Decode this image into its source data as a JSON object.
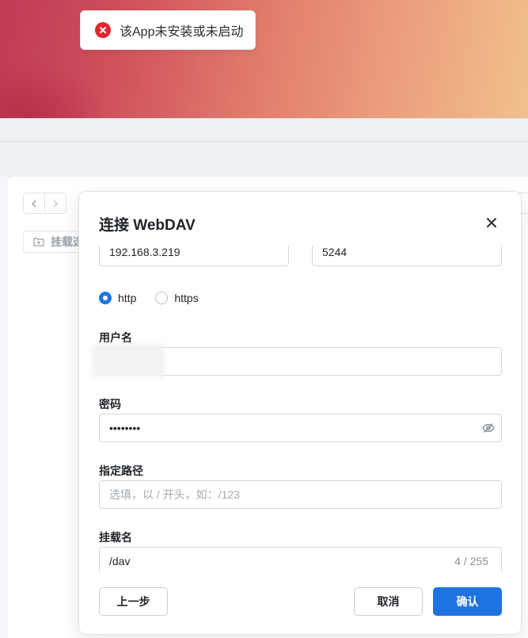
{
  "toast": {
    "icon": "error-icon",
    "message": "该App未安装或未启动",
    "color": "#e5242d"
  },
  "background": {
    "mount_button_label": "挂载选",
    "mount_icon": "folder-plus-icon"
  },
  "dialog": {
    "title": "连接 WebDAV",
    "close_icon": "close-icon",
    "host": {
      "value": "192.168.3.219"
    },
    "port": {
      "value": "5244"
    },
    "protocol": {
      "options": [
        "http",
        "https"
      ],
      "selected": "http"
    },
    "username": {
      "label": "用户名",
      "value": ""
    },
    "password": {
      "label": "密码",
      "value": "••••••••",
      "toggle_icon": "eye-off-icon"
    },
    "path": {
      "label": "指定路径",
      "placeholder": "选填，以 / 开头，如：/123"
    },
    "mount_name": {
      "label": "挂载名",
      "value": "/dav",
      "counter": "4 / 255"
    },
    "buttons": {
      "prev": "上一步",
      "cancel": "取消",
      "confirm": "确认"
    },
    "accent_color": "#1f73e0"
  }
}
